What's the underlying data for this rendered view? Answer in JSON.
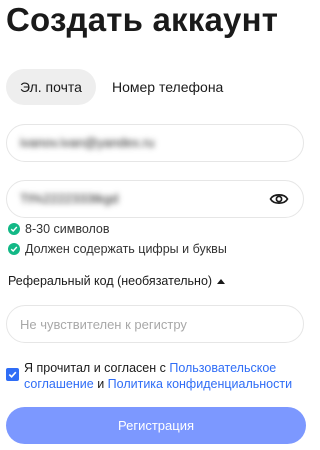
{
  "page": {
    "title": "Создать аккаунт"
  },
  "tabs": [
    {
      "label": "Эл. почта",
      "active": true
    },
    {
      "label": "Номер телефона",
      "active": false
    }
  ],
  "email_field": {
    "value": "ivanov.ivan@yandex.ru"
  },
  "password_field": {
    "value": "Tt%2222333tkgd",
    "toggle_icon": "eye-icon"
  },
  "password_rules": [
    {
      "text": "8-30 символов",
      "icon": "check-circle-icon"
    },
    {
      "text": "Должен содержать цифры и буквы",
      "icon": "check-circle-icon"
    }
  ],
  "referral": {
    "label": "Реферальный код (необязательно)",
    "placeholder": "Не чувствителен к регистру"
  },
  "agreement": {
    "checked": true,
    "prefix": "Я прочитал и согласен с",
    "link1": "Пользовательское соглашение",
    "joiner": "и",
    "link2": "Политика конфиденциальности"
  },
  "submit": {
    "label": "Регистрация"
  },
  "colors": {
    "accent": "#2f6df6",
    "button": "#7c98ff",
    "check_green": "#12b886"
  }
}
